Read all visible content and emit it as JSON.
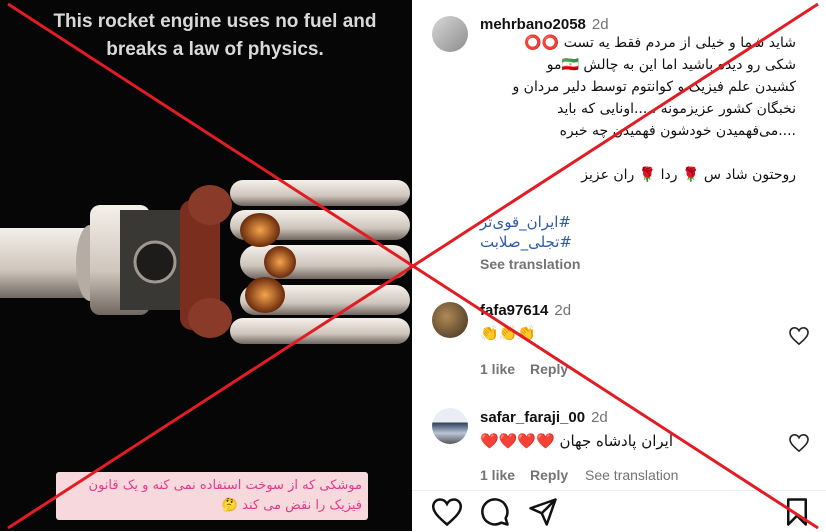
{
  "video": {
    "top_caption": "This rocket engine uses no fuel and breaks a law of physics.",
    "bottom_caption": "موشکی که از سوخت استفاده نمی کنه و یک قانون فیزیک را نقض می کند 🤔"
  },
  "post": {
    "username": "mehrbano2058",
    "time": "2d",
    "lines": [
      "شاید شما و خیلی از مردم فقط یه تست ⭕⭕",
      "شکی رو دیده باشید اما این به چالش 🇮🇷مو",
      "کشیدن علم فیزیک و کوانتوم توسط دلیر مردان و",
      "نخبگان کشور عزیزمونه .....اونایی که باید",
      "....می‌فهمیدن خودشون فهمیدن چه خبره",
      "",
      "روحتون شاد س 🌹 ردا 🌹 ران عزیز"
    ],
    "hashtags": [
      "#ایران_قوی‌تر",
      "#تجلی_صلابت"
    ],
    "see_translation": "See translation"
  },
  "comments": [
    {
      "username": "fafa97614",
      "time": "2d",
      "text": "👏👏👏",
      "likes": "1 like",
      "reply": "Reply"
    },
    {
      "username": "safar_faraji_00",
      "time": "2d",
      "text": "ایران پادشاه جهان ❤️❤️❤️❤️",
      "likes": "1 like",
      "reply": "Reply",
      "see_translation": "See translation"
    }
  ],
  "icons": {
    "like": "heart-icon",
    "comment": "comment-icon",
    "share": "share-icon",
    "save": "bookmark-icon"
  },
  "colors": {
    "cross": "#e31b23",
    "link": "#2e5ba8",
    "muted": "#737373"
  }
}
